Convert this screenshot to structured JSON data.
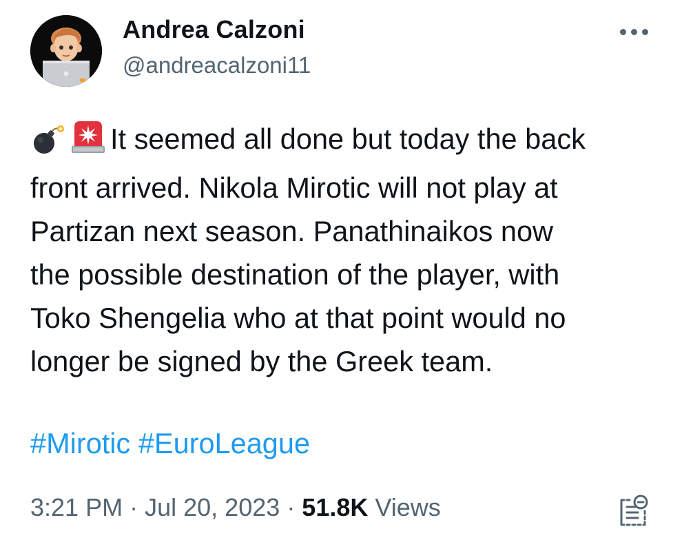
{
  "author": {
    "name": "Andrea Calzoni",
    "handle": "@andreacalzoni11",
    "avatar_icon": "memoji-laptop-avatar"
  },
  "tweet": {
    "emojis": [
      "bomb-emoji",
      "police-light-emoji"
    ],
    "lines": [
      "It seemed all done but today the back",
      "front arrived. Nikola Mirotic will not play at",
      "Partizan next season. Panathinaikos now",
      "the possible destination of the player, with",
      "Toko Shengelia who at that point would no",
      "longer be signed by the Greek team."
    ],
    "hashtags": [
      "#Mirotic",
      "#EuroLeague"
    ]
  },
  "meta": {
    "time": "3:21 PM",
    "separator": "·",
    "date": "Jul 20, 2023",
    "views_count": "51.8K",
    "views_label": "Views"
  },
  "colors": {
    "link": "#1d9bf0",
    "secondary_text": "#536471",
    "primary_text": "#0f1419"
  },
  "icons": {
    "more": "more-dots-icon",
    "analytics": "analytics-icon"
  }
}
